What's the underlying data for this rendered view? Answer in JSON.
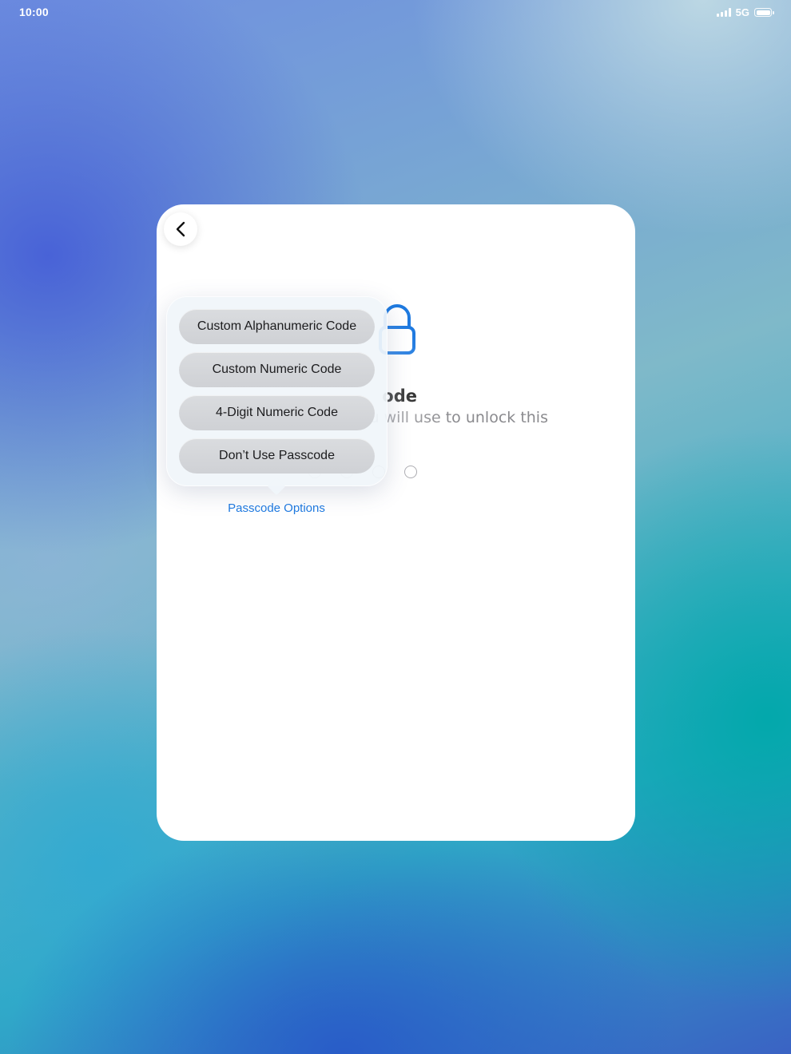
{
  "status_bar": {
    "time": "10:00",
    "network": "5G",
    "icons": [
      "signal-icon",
      "battery-icon"
    ]
  },
  "sheet": {
    "back_icon": "chevron-left-icon",
    "lock_icon": "lock-icon",
    "title_visible": "ode",
    "subtitle_visible": "u will use to unlock this",
    "passcode_options_label": "Passcode Options"
  },
  "popover": {
    "items": [
      {
        "label": "Custom Alphanumeric Code"
      },
      {
        "label": "Custom Numeric Code"
      },
      {
        "label": "4-Digit Numeric Code"
      },
      {
        "label": "Don’t Use Passcode"
      }
    ]
  },
  "colors": {
    "accent": "#1f7ae0",
    "lock": "#1f7ae0"
  }
}
